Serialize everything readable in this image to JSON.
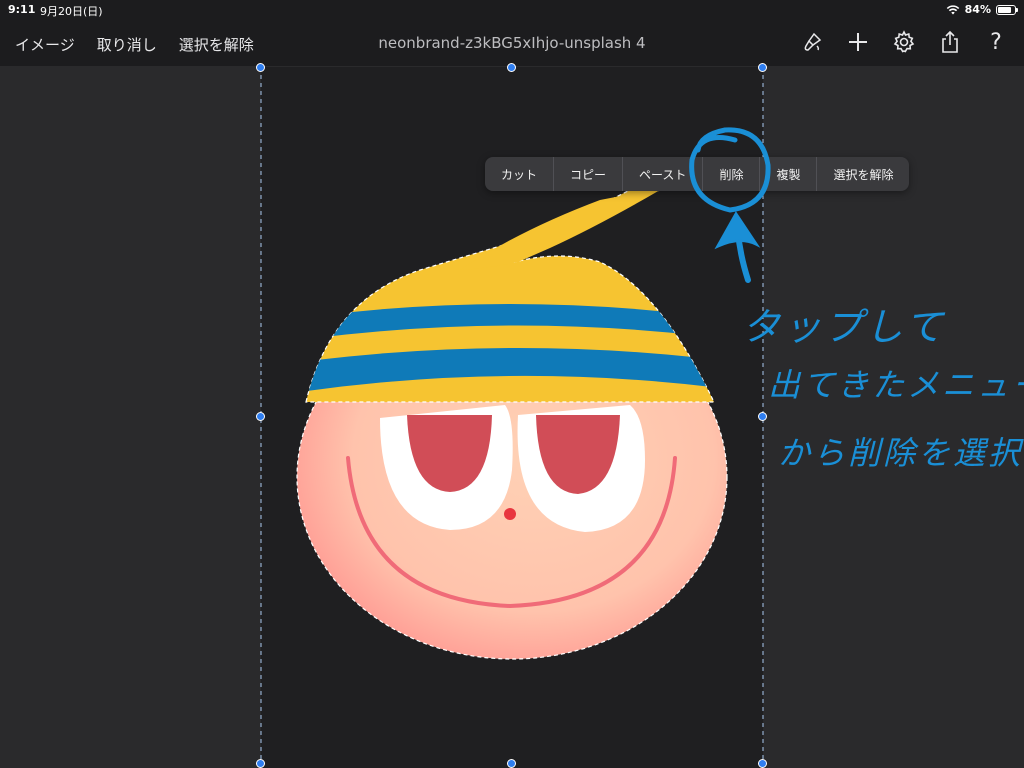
{
  "status_bar": {
    "time": "9:11",
    "date": "9月20日(日)",
    "battery": "84%",
    "battery_level": 0.84
  },
  "toolbar": {
    "left_items": [
      "イメージ",
      "取り消し",
      "選択を解除"
    ],
    "title": "neonbrand-z3kBG5xIhjo-unsplash 4",
    "icons": [
      "paintbrush-icon",
      "add-icon",
      "gear-icon",
      "share-icon",
      "help-icon"
    ],
    "help_glyph": "?"
  },
  "context_menu": {
    "items": [
      "カット",
      "コピー",
      "ペースト",
      "削除",
      "複製",
      "選択を解除"
    ]
  },
  "annotation": {
    "line1": "タップして",
    "line2": "出てきたメニュー",
    "line3": "から削除を選択",
    "color": "#1a8fd6"
  },
  "colors": {
    "background": "#1c1c1e",
    "canvas": "#2a2a2c",
    "artboard": "#1f1f21",
    "selection_handle": "#2f7ef0",
    "hat_yellow": "#f6c431",
    "hat_blue": "#0f7ab8",
    "eye_red": "#d14d57",
    "smile": "#f06b78"
  }
}
